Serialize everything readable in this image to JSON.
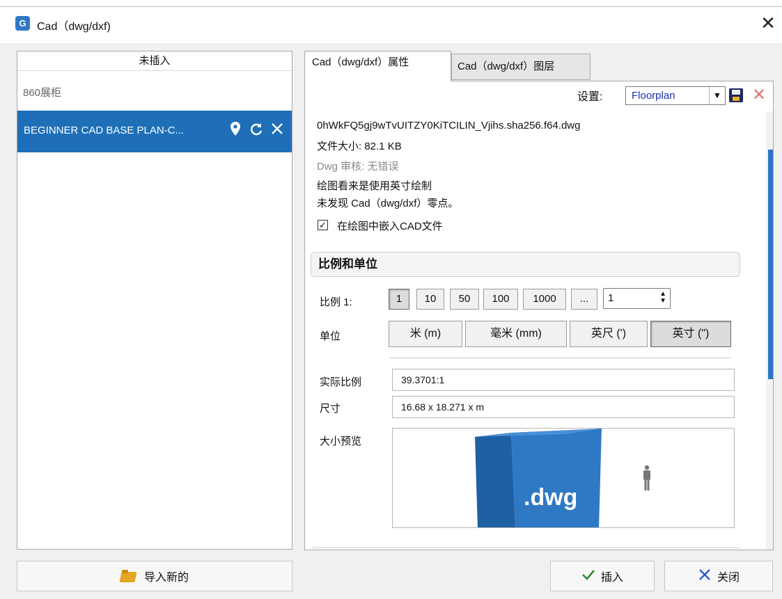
{
  "window": {
    "icon_text": "G",
    "title": "Cad（dwg/dxf)",
    "close_glyph": "✕"
  },
  "left": {
    "header": "未插入",
    "items": [
      {
        "label": "860展柜"
      },
      {
        "label": "BEGINNER CAD BASE PLAN-C..."
      }
    ],
    "item_icons": [
      "map-pin-icon",
      "refresh-icon",
      "close-icon"
    ],
    "import_label": "导入新的"
  },
  "tabs": [
    {
      "label": "Cad（dwg/dxf）属性"
    },
    {
      "label": "Cad（dwg/dxf）图层"
    }
  ],
  "settings": {
    "label": "设置:",
    "value": "Floorplan"
  },
  "file_info": {
    "filename": "0hWkFQ5gj9wTvUITZY0KiTCILIN_Vjihs.sha256.f64.dwg",
    "size": "文件大小: 82.1 KB",
    "audit": "Dwg 审核:  无错误",
    "units_note": "绘图看来是使用英寸绘制",
    "origin_note": "未发现 Cad（dwg/dxf）零点。",
    "embed_label": "在绘图中嵌入CAD文件",
    "embed_checked": true
  },
  "scale_section": {
    "title": "比例和单位",
    "scale_label": "比例 1:",
    "scale_buttons": [
      "1",
      "10",
      "50",
      "100",
      "1000",
      "..."
    ],
    "scale_selected": "1",
    "scale_value": "1",
    "unit_label": "单位",
    "unit_buttons": [
      "米 (m)",
      "毫米 (mm)",
      "英尺 (')",
      "英寸 (\")"
    ],
    "unit_selected": "英寸 (\")",
    "actual_scale_label": "实际比例",
    "actual_scale_value": "39.3701:1",
    "size_label": "尺寸",
    "size_value": "16.68 x 18.271 x  m",
    "preview_label": "大小预览",
    "preview_text": ".dwg"
  },
  "footer": {
    "insert_label": "插入",
    "close_label": "关闭"
  },
  "colors": {
    "accent": "#1e6fb8",
    "cube_front": "#2f78c4",
    "cube_side": "#1f5fa3",
    "delete_icon": "#e07272"
  }
}
